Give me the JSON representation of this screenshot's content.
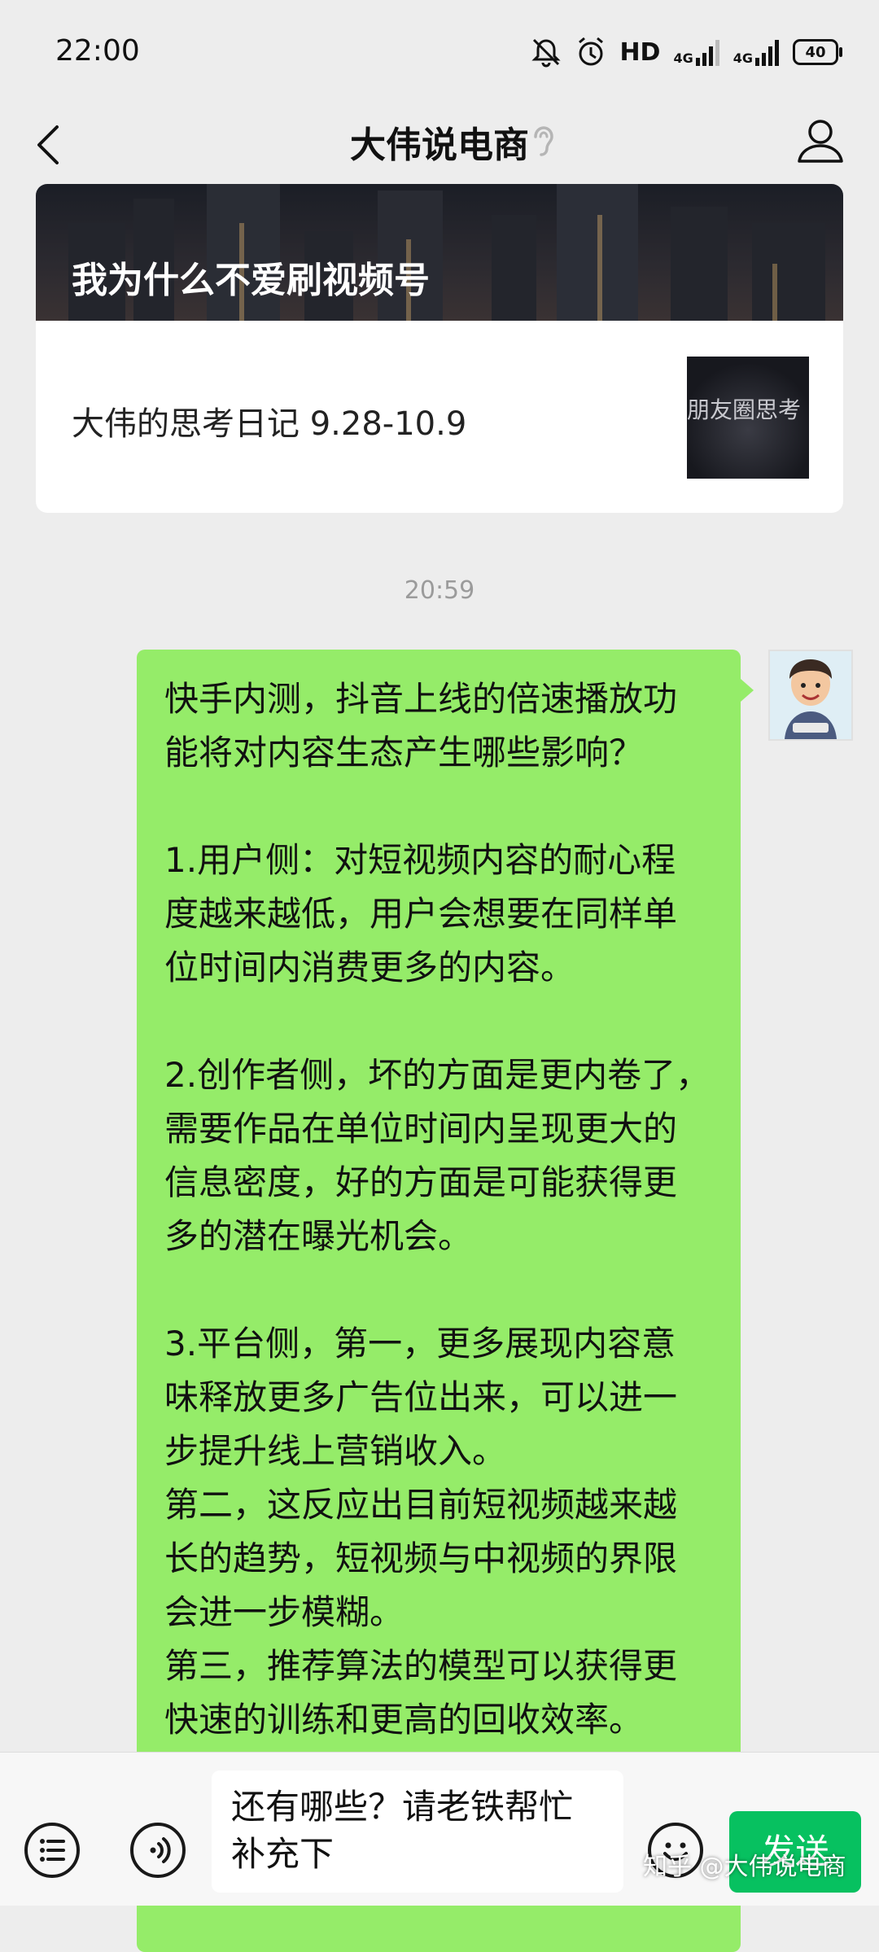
{
  "status_bar": {
    "time": "22:00",
    "hd_label": "HD",
    "network_1": "4G",
    "network_2": "4G",
    "battery": "40"
  },
  "header": {
    "title": "大伟说电商"
  },
  "article": {
    "cover_title": "我为什么不爱刷视频号",
    "subtitle": "大伟的思考日记 9.28-10.9",
    "thumb_text": "朋友圈思考"
  },
  "chat": {
    "timestamp": "20:59",
    "message_lines": [
      "快手内测，抖音上线的倍速播放功",
      "能将对内容生态产生哪些影响？",
      "",
      "1.用户侧：对短视频内容的耐心程",
      "度越来越低，用户会想要在同样单",
      "位时间内消费更多的内容。",
      "",
      "2.创作者侧，坏的方面是更内卷了，",
      "需要作品在单位时间内呈现更大的",
      "信息密度，好的方面是可能获得更",
      "多的潜在曝光机会。",
      "",
      "3.平台侧，第一，更多展现内容意",
      "味释放更多广告位出来，可以进一",
      "步提升线上营销收入。",
      "第二，这反应出目前短视频越来越",
      "长的趋势，短视频与中视频的界限",
      "会进一步模糊。",
      "第三，推荐算法的模型可以获得更",
      "快速的训练和更高的回收效率。"
    ]
  },
  "input": {
    "line_1": "还有哪些？请老铁帮忙",
    "line_2": "补充下",
    "send_label": "发送"
  },
  "watermark": "知乎 @大伟说电商"
}
